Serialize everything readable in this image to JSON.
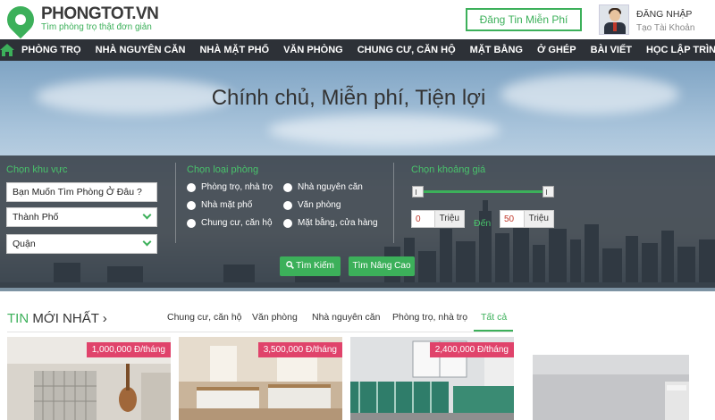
{
  "header": {
    "logo_name": "PHONGTOT.VN",
    "logo_slogan": "Tìm phòng trọ thật đơn giản",
    "post_button": "Đăng Tin Miễn Phí",
    "login_label": "ĐĂNG NHẬP",
    "register_label": "Tạo Tài Khoản"
  },
  "nav": {
    "home_icon": "home-icon",
    "items": [
      "PHÒNG TRỌ",
      "NHÀ NGUYÊN CĂN",
      "NHÀ MẶT PHỐ",
      "VĂN PHÒNG",
      "CHUNG CƯ, CĂN HỘ",
      "MẶT BẰNG",
      "Ở GHÉP",
      "BÀI VIẾT",
      "HỌC LẬP TRÌNH"
    ]
  },
  "hero": {
    "title": "Chính chủ, Miễn phí, Tiện lợi"
  },
  "search": {
    "area_label": "Chọn khu vực",
    "area_placeholder": "Bạn Muốn Tìm Phòng Ở Đâu ?",
    "city_select": "Thành Phố",
    "district_select": "Quận",
    "type_label": "Chọn loại phòng",
    "types": [
      "Phòng trọ, nhà trọ",
      "Nhà nguyên căn",
      "Nhà mặt phố",
      "Văn phòng",
      "Chung cư, căn hộ",
      "Mặt bằng, cửa hàng"
    ],
    "price_label": "Chọn khoảng giá",
    "price_min": "0",
    "price_max": "50",
    "price_unit": "Triệu",
    "price_to": "Đến",
    "search_button": "Tìm Kiếm",
    "advanced_button": "Tìm Nâng Cao"
  },
  "listings": {
    "title_green": "TIN",
    "title_rest": "MỚI NHẤT",
    "tabs": [
      "Chung cư, căn hộ",
      "Văn phòng",
      "Nhà nguyên căn",
      "Phòng trọ, nhà trọ",
      "Tất cả"
    ],
    "active_tab": "Tất cả",
    "cards": [
      {
        "price": "1,000,000 Đ/tháng"
      },
      {
        "price": "3,500,000 Đ/tháng"
      },
      {
        "price": "2,400,000 Đ/tháng"
      }
    ]
  },
  "colors": {
    "brand_green": "#3cb05a",
    "nav_bg": "#2d3137",
    "price_tag": "#e0436b"
  }
}
